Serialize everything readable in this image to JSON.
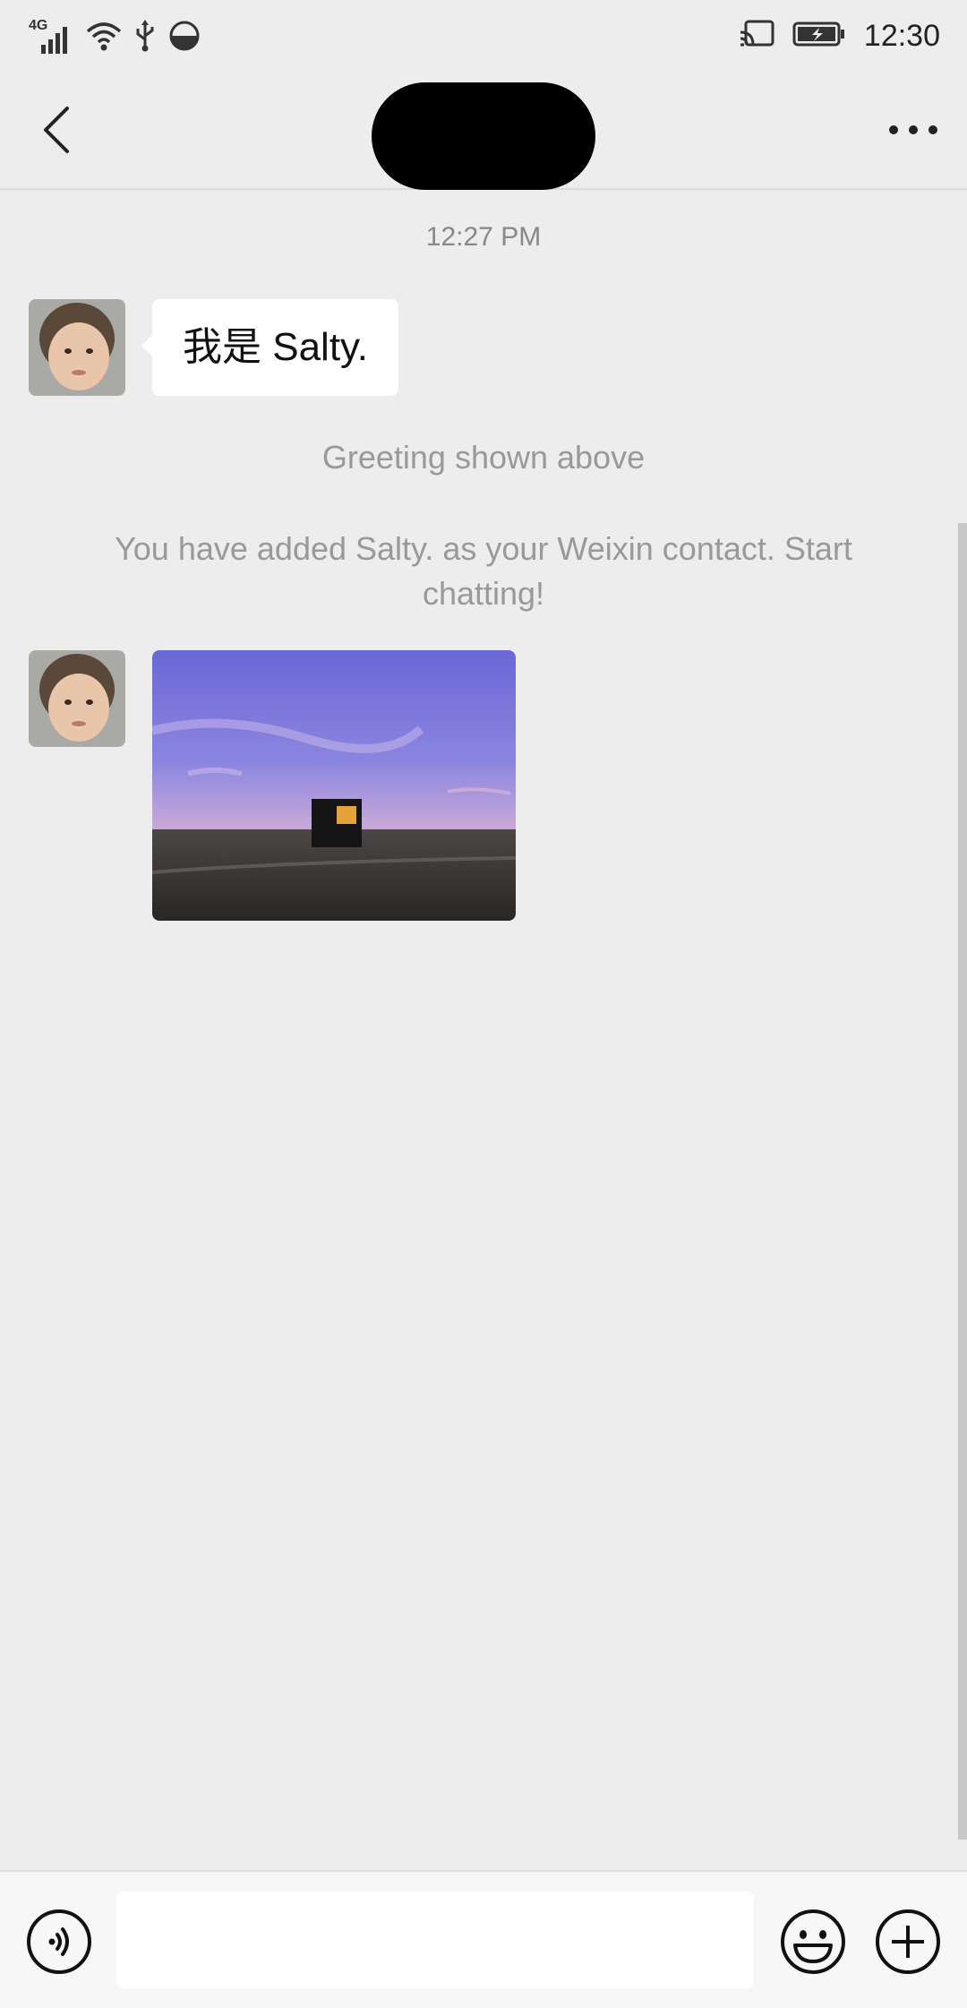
{
  "status_bar": {
    "network_label": "4G",
    "time": "12:30"
  },
  "header": {
    "back_icon": "chevron-left-icon",
    "more_icon": "more-dots-icon"
  },
  "chat": {
    "timestamp": "12:27 PM",
    "messages": [
      {
        "type": "text",
        "sender": "contact",
        "text": "我是 Salty."
      },
      {
        "type": "system",
        "text": "Greeting shown above"
      },
      {
        "type": "system",
        "text": "You have added Salty. as your Weixin contact. Start chatting!"
      },
      {
        "type": "image",
        "sender": "contact",
        "description": ""
      }
    ]
  },
  "input_bar": {
    "value": "",
    "placeholder": "",
    "icons": [
      "voice-icon",
      "emoji-icon",
      "plus-icon"
    ]
  },
  "colors": {
    "background": "#ededed",
    "bubble": "#ffffff",
    "system_text": "#999999"
  }
}
